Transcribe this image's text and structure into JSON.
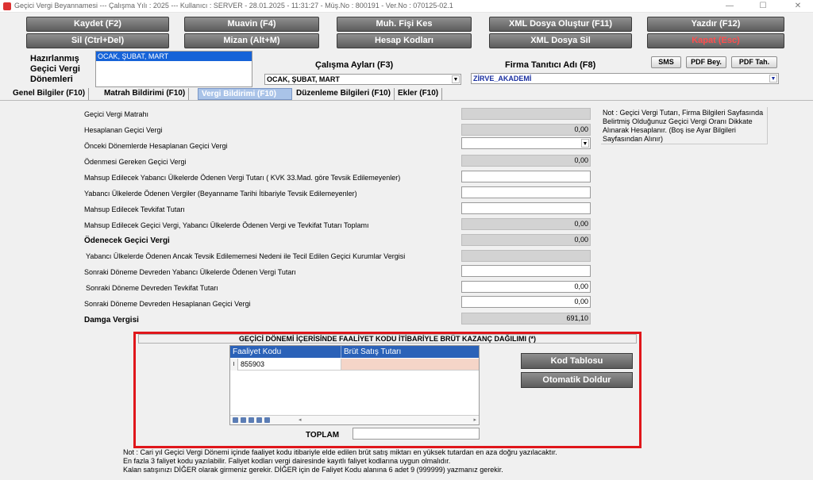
{
  "window": {
    "title": "Geçici Vergi Beyannamesi  ---  Çalışma Yılı : 2025  ---  Kullanıcı : SERVER - 28.01.2025 - 11:31:27 - Müş.No : 800191 - Ver.No : 070125-02.1",
    "min": "—",
    "max": "☐",
    "close": "✕"
  },
  "toolbar": {
    "row1": [
      "Kaydet (F2)",
      "Muavin (F4)",
      "Muh. Fişi Kes",
      "XML Dosya Oluştur (F11)",
      "Yazdır (F12)"
    ],
    "row2": [
      "Sil (Ctrl+Del)",
      "Mizan (Alt+M)",
      "Hesap Kodları",
      "XML Dosya Sil",
      "Kapat (Esc)"
    ]
  },
  "header": {
    "periods_label_1": "Hazırlanmış",
    "periods_label_2": "Geçici Vergi",
    "periods_label_3": "Dönemleri",
    "periods_selected": "OCAK, ŞUBAT, MART",
    "months_label": "Çalışma Ayları (F3)",
    "months_value": "OCAK, ŞUBAT, MART",
    "firm_label": "Firma Tanıtıcı Adı (F8)",
    "firm_value": "ZİRVE_AKADEMİ",
    "sms": "SMS",
    "pdf_bey": "PDF Bey.",
    "pdf_tah": "PDF Tah."
  },
  "tabs": [
    "Genel Bilgiler (F10)",
    "Matrah Bildirimi (F10)",
    "Vergi Bildirimi (F10)",
    "Düzenleme Bilgileri (F10)",
    "Ekler (F10)"
  ],
  "rows": [
    {
      "label": "Geçici Vergi Matrahı",
      "value": ""
    },
    {
      "label": "Hesaplanan Geçici Vergi",
      "value": "0,00"
    },
    {
      "label": "Önceki Dönemlerde Hesaplanan Geçici Vergi",
      "value": ""
    },
    {
      "label": "Ödenmesi Gereken Geçici Vergi",
      "value": "0,00"
    },
    {
      "label": "Mahsup Edilecek Yabancı Ülkelerde Ödenen Vergi Tutarı ( KVK 33.Mad. göre Tevsik Edilemeyenler)",
      "value": ""
    },
    {
      "label": "Yabancı Ülkelerde Ödenen Vergiler (Beyanname Tarihi İtibariyle Tevsik Edilemeyenler)",
      "value": ""
    },
    {
      "label": "Mahsup Edilecek Tevkifat Tutarı",
      "value": ""
    },
    {
      "label": "Mahsup Edilecek Geçici Vergi, Yabancı Ülkelerde Ödenen Vergi ve Tevkifat Tutarı Toplamı",
      "value": "0,00"
    },
    {
      "label": "Ödenecek Geçici Vergi",
      "value": "0,00"
    },
    {
      "label": "Yabancı Ülkelerde Ödenen Ancak Tevsik Edilememesi Nedeni ile Tecil Edilen Geçici Kurumlar Vergisi",
      "value": ""
    },
    {
      "label": "Sonraki Döneme Devreden Yabancı Ülkelerde Ödenen Vergi Tutarı",
      "value": ""
    },
    {
      "label": "Sonraki Döneme Devreden Tevkifat Tutarı",
      "value": "0,00"
    },
    {
      "label": "Sonraki Döneme Devreden Hesaplanan Geçici Vergi",
      "value": "0,00"
    },
    {
      "label": "Damga Vergisi",
      "value": "691,10"
    }
  ],
  "note": "Not : Geçici Vergi Tutarı, Firma Bilgileri Sayfasında Belirtmiş Olduğunuz Geçici Vergi Oranı Dikkate Alınarak Hesaplanır. (Boş ise Ayar Bilgileri Sayfasından Alınır)",
  "distribution": {
    "title": "GEÇİCİ DÖNEMİ İÇERİSİNDE FAALİYET KODU İTİBARİYLE BRÜT KAZANÇ DAĞILIMI (*)",
    "col1": "Faaliyet Kodu",
    "col2": "Brüt Satış Tutarı",
    "row_marker": "I",
    "code": "855903",
    "total_label": "TOPLAM",
    "btn_code_table": "Kod Tablosu",
    "btn_autofill": "Otomatik Doldur"
  },
  "bottom_notes": [
    "Not : Cari yıl Geçici Vergi Dönemi içinde faaliyet kodu itibariyle elde edilen brüt satış miktarı en yüksek tutardan en aza doğru yazılacaktır.",
    "En fazla 3 faliyet kodu yazılabilir.      Faliyet kodları vergi dairesinde kayıtlı faliyet kodlarına uygun olmalıdır.",
    "Kalan satışınızı DİĞER olarak girmeniz gerekir.  DİĞER için de Faliyet Kodu alanına 6 adet 9 (999999) yazmanız gerekir."
  ]
}
